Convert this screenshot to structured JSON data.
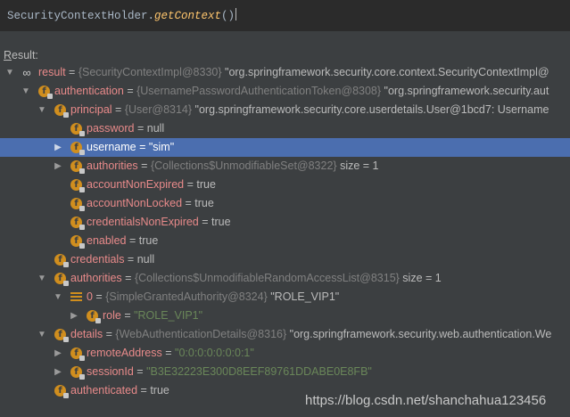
{
  "expression": {
    "class_text": "SecurityContextHolder.",
    "method_text": "getContext",
    "parens": "()"
  },
  "result_label": "esult:",
  "result_label_underlined": "R",
  "tree": [
    {
      "name": "result",
      "eq": " = ",
      "ref": "{SecurityContextImpl@8330}",
      "value": " \"org.springframework.security.core.context.SecurityContextImpl@"
    },
    {
      "name": "authentication",
      "eq": " = ",
      "ref": "{UsernamePasswordAuthenticationToken@8308}",
      "value": " \"org.springframework.security.aut"
    },
    {
      "name": "principal",
      "eq": " = ",
      "ref": "{User@8314}",
      "value": " \"org.springframework.security.core.userdetails.User@1bcd7: Username"
    },
    {
      "name": "password",
      "eq": " = ",
      "value": "null"
    },
    {
      "name": "username",
      "eq": " = ",
      "str": "\"sim\""
    },
    {
      "name": "authorities",
      "eq": " = ",
      "ref": "{Collections$UnmodifiableSet@8322}",
      "value": "  size = 1"
    },
    {
      "name": "accountNonExpired",
      "eq": " = ",
      "value": "true"
    },
    {
      "name": "accountNonLocked",
      "eq": " = ",
      "value": "true"
    },
    {
      "name": "credentialsNonExpired",
      "eq": " = ",
      "value": "true"
    },
    {
      "name": "enabled",
      "eq": " = ",
      "value": "true"
    },
    {
      "name": "credentials",
      "eq": " = ",
      "value": "null"
    },
    {
      "name": "authorities",
      "eq": " = ",
      "ref": "{Collections$UnmodifiableRandomAccessList@8315}",
      "value": "  size = 1"
    },
    {
      "name": "0",
      "eq": " = ",
      "ref": "{SimpleGrantedAuthority@8324}",
      "value": " \"ROLE_VIP1\""
    },
    {
      "name": "role",
      "eq": " = ",
      "str": "\"ROLE_VIP1\""
    },
    {
      "name": "details",
      "eq": " = ",
      "ref": "{WebAuthenticationDetails@8316}",
      "value": " \"org.springframework.security.web.authentication.We"
    },
    {
      "name": "remoteAddress",
      "eq": " = ",
      "str": "\"0:0:0:0:0:0:0:1\""
    },
    {
      "name": "sessionId",
      "eq": " = ",
      "str": "\"B3E32223E300D8EEF89761DDABE0E8FB\""
    },
    {
      "name": "authenticated",
      "eq": " = ",
      "value": "true"
    }
  ],
  "watermark": "https://blog.csdn.net/shanchahua123456",
  "colors": {
    "background": "#3c3f41",
    "editor": "#2b2b2b",
    "selection": "#4b6eaf",
    "field_icon": "#d08e1e",
    "field_name": "#e88a8a",
    "string": "#6a8759",
    "reference": "#808080"
  }
}
